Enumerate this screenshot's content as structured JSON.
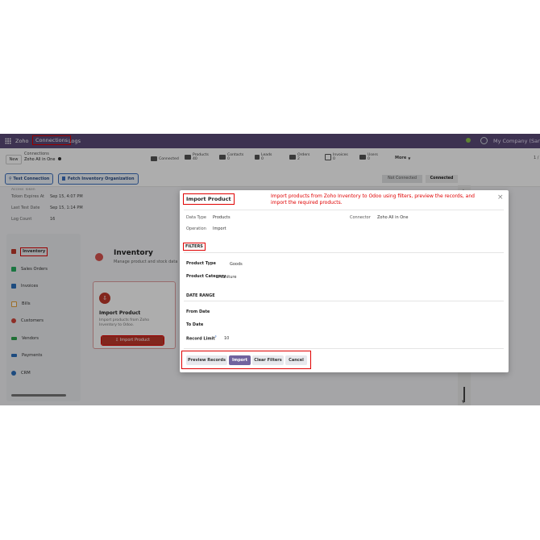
{
  "topnav": {
    "app": "Zoho",
    "menu_connections": "Connections",
    "menu_logs": "Logs",
    "company": "My Company (San Fra"
  },
  "control_panel": {
    "new_label": "New",
    "breadcrumb_parent": "Connections",
    "breadcrumb_record": "Zoho All in One",
    "stats": [
      {
        "label": "Connected",
        "value": ""
      },
      {
        "label": "Products",
        "value": "40"
      },
      {
        "label": "Contacts",
        "value": "0"
      },
      {
        "label": "Leads",
        "value": "0"
      },
      {
        "label": "Orders",
        "value": "2"
      },
      {
        "label": "Invoices",
        "value": "0"
      },
      {
        "label": "Users",
        "value": "0"
      }
    ],
    "more_label": "More",
    "pager": "1 /"
  },
  "actions": {
    "test_connection": "Test Connection",
    "fetch_org": "Fetch Inventory Organization",
    "status_not_connected": "Not Connected",
    "status_connected": "Connected"
  },
  "record_info": {
    "cut_label": "Access Token",
    "rows": [
      {
        "label": "Token Expires At",
        "value": "Sep 15, 4:07 PM"
      },
      {
        "label": "Last Test Date",
        "value": "Sep 15, 1:14 PM"
      },
      {
        "label": "Log Count",
        "value": "16"
      }
    ]
  },
  "sidebar": {
    "items": [
      {
        "label": "Inventory",
        "color": "#c0392b"
      },
      {
        "label": "Sales Orders",
        "color": "#27ae60"
      },
      {
        "label": "Invoices",
        "color": "#2c6fbb"
      },
      {
        "label": "Bills",
        "color": "#e6a23c"
      },
      {
        "label": "Customers",
        "color": "#d0443a"
      },
      {
        "label": "Vendors",
        "color": "#2ea44f"
      },
      {
        "label": "Payments",
        "color": "#2c6fbb"
      },
      {
        "label": "CRM",
        "color": "#2c6fbb"
      }
    ]
  },
  "main": {
    "title": "Inventory",
    "subtitle": "Manage product and stock data",
    "card_title": "Import Product",
    "card_desc": "Import products from Zoho Inventory to Odoo.",
    "card_button": "Import Product"
  },
  "modal": {
    "title": "Import Product",
    "annotation": "Import products from Zoho Inventory to Odoo using filters, preview the records, and import the required products.",
    "data_type_label": "Data Type",
    "data_type_value": "Products",
    "operation_label": "Operation",
    "operation_value": "Import",
    "connector_label": "Connector",
    "connector_value": "Zoho All in One",
    "filters_header": "FILTERS",
    "product_type_label": "Product Type",
    "product_type_value": "Goods",
    "product_category_label": "Product Category",
    "product_category_value": "Furniture",
    "date_range_header": "DATE RANGE",
    "from_date_label": "From Date",
    "to_date_label": "To Date",
    "record_limit_label": "Record Limit",
    "record_limit_help": "?",
    "record_limit_value": "10",
    "buttons": {
      "preview": "Preview Records",
      "import": "Import",
      "clear": "Clear Filters",
      "cancel": "Cancel"
    }
  },
  "colors": {
    "navbar": "#5a4a78",
    "primary": "#71639e",
    "annotation_red": "#e00000"
  }
}
